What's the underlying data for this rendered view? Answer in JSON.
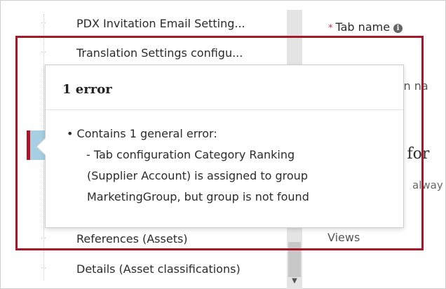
{
  "list": {
    "items": [
      {
        "label": "PDX Invitation Email Setting..."
      },
      {
        "label": "Translation Settings configu..."
      },
      {
        "label": "References (Assets)"
      },
      {
        "label": "Details (Asset classifications)"
      }
    ]
  },
  "form": {
    "tab_name_label": "Tab name",
    "partial_tion_label": "tion na",
    "partial_heading": "ns for",
    "partial_always": "alway",
    "views_label": "Views",
    "required_marker": "*",
    "info_icon_glyph": "i"
  },
  "error_popover": {
    "title": "1 error",
    "bullet": "Contains 1 general error:",
    "detail_lines": [
      "- Tab configuration Category Ranking",
      "(Supplier Account) is assigned to group",
      "MarketingGroup, but group is not found"
    ]
  },
  "colors": {
    "highlight": "#a8162a",
    "marker": "#a6cfe3",
    "required": "#c0304a"
  },
  "icons": {
    "info": "info-icon",
    "scroll_down": "chevron-down-icon"
  }
}
